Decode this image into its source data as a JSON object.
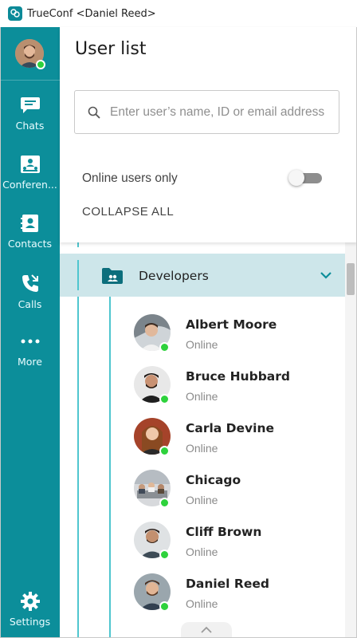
{
  "window": {
    "title": "TrueConf <Daniel Reed>"
  },
  "sidebar": {
    "items": [
      {
        "id": "chats",
        "label": "Chats"
      },
      {
        "id": "conferences",
        "label": "Conferen..."
      },
      {
        "id": "contacts",
        "label": "Contacts"
      },
      {
        "id": "calls",
        "label": "Calls"
      },
      {
        "id": "more",
        "label": "More"
      }
    ],
    "settings_label": "Settings"
  },
  "header": {
    "title": "User list",
    "search_placeholder": "Enter user’s name, ID or email address",
    "online_only_label": "Online users only",
    "online_only_enabled": false,
    "collapse_all_label": "COLLAPSE ALL"
  },
  "group": {
    "name": "Developers",
    "expanded": true
  },
  "contacts": [
    {
      "name": "Albert Moore",
      "status": "Online"
    },
    {
      "name": "Bruce Hubbard",
      "status": "Online"
    },
    {
      "name": "Carla Devine",
      "status": "Online"
    },
    {
      "name": "Chicago",
      "status": "Online"
    },
    {
      "name": "Cliff Brown",
      "status": "Online"
    },
    {
      "name": "Daniel Reed",
      "status": "Online"
    }
  ],
  "colors": {
    "sidebar": "#0c8e9a",
    "online": "#2ed23c",
    "group_bg": "#cde6ea",
    "tree_line": "#4fc6cf"
  }
}
